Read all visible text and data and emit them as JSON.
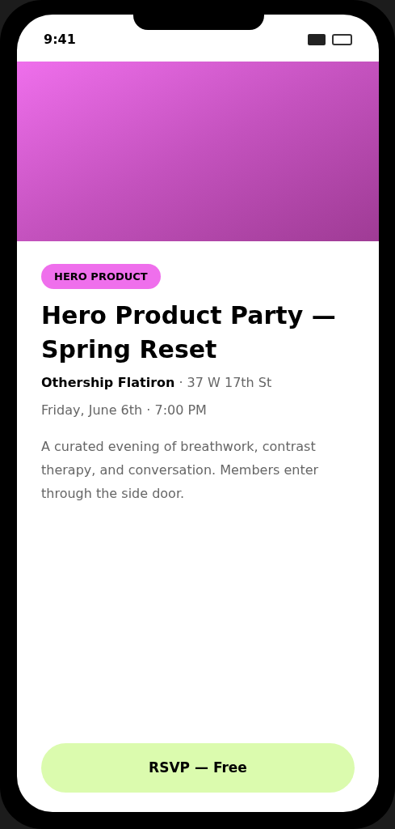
{
  "status_bar": {
    "time": "9:41"
  },
  "tag": "HERO PRODUCT",
  "title": "Hero Product Party — Spring Reset",
  "venue": {
    "name": "Othership Flatiron",
    "address": "· 37 W 17th St"
  },
  "datetime": "Friday, June 6th · 7:00 PM",
  "description": "A curated evening of breathwork, contrast therapy, and conversation. Members enter through the side door.",
  "button": "RSVP — Free"
}
